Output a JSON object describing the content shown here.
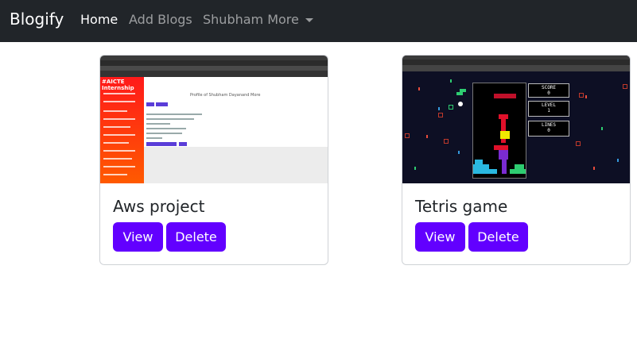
{
  "navbar": {
    "brand": "Blogify",
    "links": [
      {
        "label": "Home"
      },
      {
        "label": "Add Blogs"
      },
      {
        "label": "Shubham More"
      }
    ]
  },
  "cards": [
    {
      "title": "Aws project",
      "view_label": "View",
      "delete_label": "Delete",
      "thumb": {
        "sidebar_title": "#AICTE Internship",
        "heading": "Profile of Shubham Dayanand More"
      }
    },
    {
      "title": "Tetris game",
      "view_label": "View",
      "delete_label": "Delete",
      "thumb": {
        "score_label": "SCORE",
        "score_value": "0",
        "level_label": "LEVEL",
        "level_value": "1",
        "lines_label": "LINES",
        "lines_value": "0"
      }
    }
  ],
  "colors": {
    "navbar_bg": "#212529",
    "button_bg": "#6200ff"
  }
}
